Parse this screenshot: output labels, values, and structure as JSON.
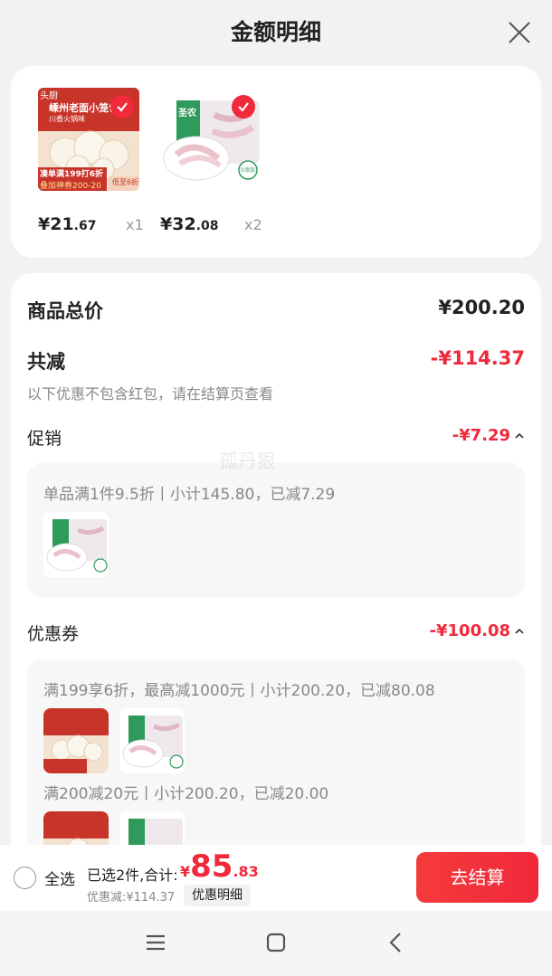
{
  "header": {
    "title": "金额明细"
  },
  "products": [
    {
      "name": "嵊州老面小笼包",
      "subtitle": "川香火锅味",
      "promo_top": "凑单满199打6折",
      "promo_bottom": "叠加神券200-20",
      "discount_tag": "低至6折",
      "brand": "头厨",
      "price_int": "¥21",
      "price_dec": ".67",
      "qty": "x1"
    },
    {
      "name": "圣农",
      "brand": "圣农",
      "badge": "0添加",
      "price_int": "¥32",
      "price_dec": ".08",
      "qty": "x2"
    }
  ],
  "detail": {
    "goods_total_label": "商品总价",
    "goods_total_value": "¥200.20",
    "reduce_label": "共减",
    "reduce_value": "-¥114.37",
    "reduce_note": "以下优惠不包含红包，请在结算页查看",
    "promo_label": "促销",
    "promo_value": "-¥7.29",
    "promo_rule": "单品满1件9.5折丨小计145.80，已减7.29",
    "coupon_label": "优惠券",
    "coupon_value": "-¥100.08",
    "coupon_rule_1": "满199享6折，最高减1000元丨小计200.20，已减80.08",
    "coupon_rule_2": "满200减20元丨小计200.20，已减20.00"
  },
  "watermark": "孤丹狠",
  "bottom": {
    "select_all": "全选",
    "selected_info": "已选2件,合计:",
    "total_currency": "¥",
    "total_int": "85",
    "total_dec": ".83",
    "discount_text": "优惠减:¥114.37",
    "detail_chip": "优惠明细",
    "checkout": "去结算"
  },
  "colors": {
    "accent": "#f0293b",
    "background": "#f2f2f2"
  },
  "icons": [
    "close-icon",
    "check-icon",
    "chevron-up-icon",
    "menu-icon",
    "home-icon",
    "back-icon"
  ]
}
